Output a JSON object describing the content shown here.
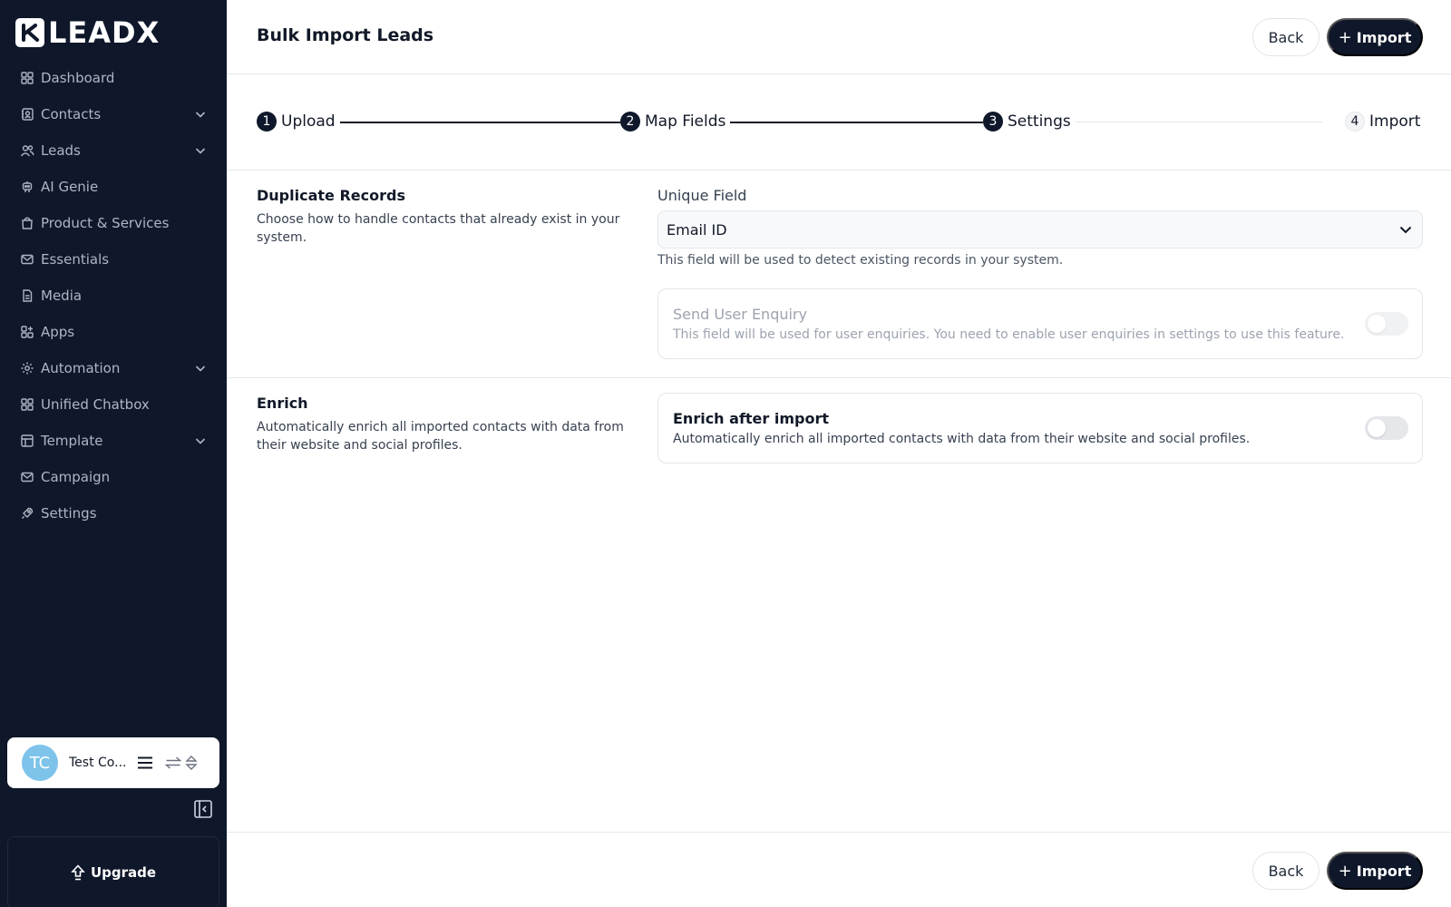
{
  "brand": {
    "logo_text": "LEADX"
  },
  "sidebar": {
    "items": [
      {
        "label": "Dashboard",
        "icon": "dashboard-grid-icon",
        "has_chevron": false
      },
      {
        "label": "Contacts",
        "icon": "contacts-icon",
        "has_chevron": true
      },
      {
        "label": "Leads",
        "icon": "users-icon",
        "has_chevron": true
      },
      {
        "label": "AI Genie",
        "icon": "robot-icon",
        "has_chevron": false
      },
      {
        "label": "Product & Services",
        "icon": "shopping-bag-icon",
        "has_chevron": false
      },
      {
        "label": "Essentials",
        "icon": "mail-icon",
        "has_chevron": false
      },
      {
        "label": "Media",
        "icon": "file-icon",
        "has_chevron": false
      },
      {
        "label": "Apps",
        "icon": "apps-grid-icon",
        "has_chevron": false
      },
      {
        "label": "Automation",
        "icon": "automation-gear-icon",
        "has_chevron": true
      },
      {
        "label": "Unified Chatbox",
        "icon": "chatbox-grid-icon",
        "has_chevron": false
      },
      {
        "label": "Template",
        "icon": "template-icon",
        "has_chevron": true
      },
      {
        "label": "Campaign",
        "icon": "campaign-mail-icon",
        "has_chevron": false
      },
      {
        "label": "Settings",
        "icon": "rocket-icon",
        "has_chevron": false
      }
    ],
    "user": {
      "initials": "TC",
      "name": "Test Co..."
    },
    "upgrade_label": "Upgrade"
  },
  "header": {
    "title": "Bulk Import Leads",
    "back_label": "Back",
    "import_plus": "+",
    "import_label": "Import"
  },
  "stepper": {
    "steps": [
      {
        "number": "1",
        "label": "Upload",
        "status": "complete"
      },
      {
        "number": "2",
        "label": "Map Fields",
        "status": "complete"
      },
      {
        "number": "3",
        "label": "Settings",
        "status": "current"
      },
      {
        "number": "4",
        "label": "Import",
        "status": "pending"
      }
    ]
  },
  "duplicate": {
    "title": "Duplicate Records",
    "description": "Choose how to handle contacts that already exist in your system.",
    "unique_field_label": "Unique Field",
    "unique_field_value": "Email ID",
    "unique_field_hint": "This field will be used to detect existing records in your system.",
    "enquiry_title": "Send User Enquiry",
    "enquiry_desc": "This field will be used for user enquiries. You need to enable user enquiries in settings to use this feature.",
    "enquiry_enabled": false
  },
  "enrich": {
    "title": "Enrich",
    "description": "Automatically enrich all imported contacts with data from their website and social profiles.",
    "toggle_title": "Enrich after import",
    "toggle_desc": "Automatically enrich all imported contacts with data from their website and social profiles.",
    "enabled": false
  },
  "footer": {
    "back_label": "Back",
    "import_plus": "+",
    "import_label": "Import"
  },
  "colors": {
    "sidebar_bg": "#0f172a",
    "primary": "#0f172a",
    "avatar": "#7dc3ea"
  }
}
